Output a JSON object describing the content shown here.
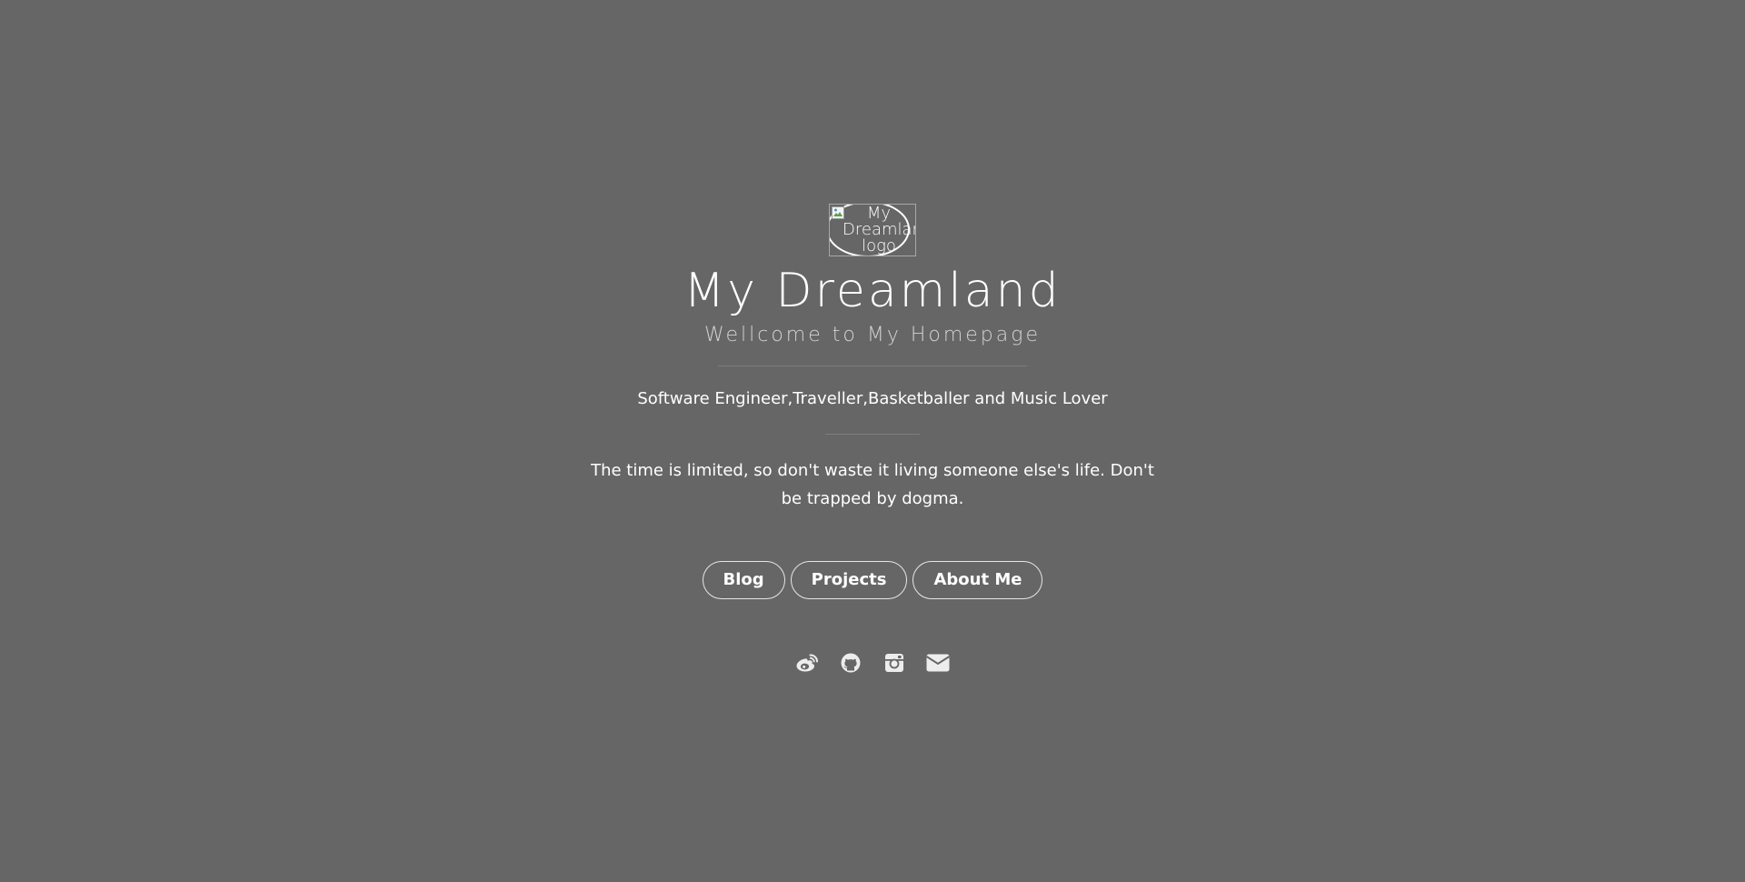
{
  "logo": {
    "alt_text": "My\nDreamland\nlogo",
    "broken_image_icon": "broken-image-icon"
  },
  "header": {
    "title": "My Dreamland",
    "subtitle": "Wellcome to My Homepage"
  },
  "tagline": "Software Engineer,Traveller,Basketballer and Music Lover",
  "quote": "The time is limited, so don't waste it living someone else's life. Don't be trapped by dogma.",
  "nav": {
    "blog_label": "Blog",
    "projects_label": "Projects",
    "about_label": "About Me"
  },
  "social": {
    "icons": [
      "weibo-icon",
      "github-icon",
      "instagram-icon",
      "email-icon"
    ],
    "icon_color": "#ededed"
  },
  "colors": {
    "background": "#666666",
    "text": "#ffffff",
    "subtitle": "#d2d2d2",
    "divider": "#7d7d7d"
  }
}
